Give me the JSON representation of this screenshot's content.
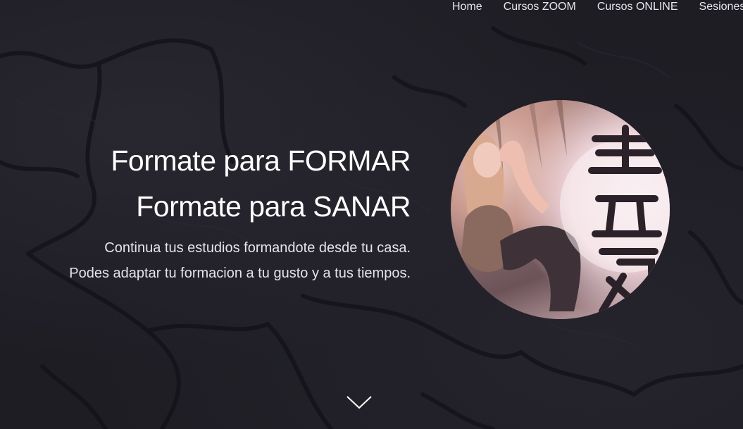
{
  "nav": {
    "items": [
      {
        "label": "Home"
      },
      {
        "label": "Cursos ZOOM"
      },
      {
        "label": "Cursos ONLINE"
      },
      {
        "label": "Sesiones"
      }
    ]
  },
  "hero": {
    "headline_line1": "Formate para FORMAR",
    "headline_line2": "Formate para SANAR",
    "subtitle_line1": "Continua tus estudios formandote desde tu casa.",
    "subtitle_line2": "Podes adaptar tu formacion a tu gusto y a tus tiempos.",
    "scroll_icon": "chevron-down-icon",
    "portrait_image": "woman-with-reiki-kanji-photo"
  },
  "colors": {
    "background": "#1e1d24",
    "text": "#ffffff",
    "nav_text": "#e9e6ee"
  }
}
